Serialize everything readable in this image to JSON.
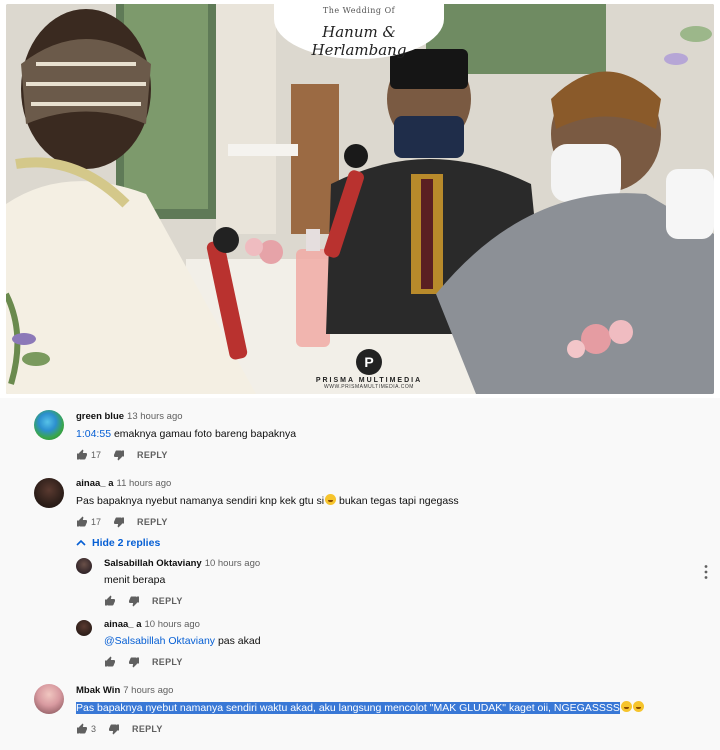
{
  "video": {
    "banner_small": "The Wedding Of",
    "banner_names": "Hanum & Herlambang",
    "watermark_text": "PRISMA MULTIMEDIA",
    "watermark_url": "WWW.PRISMAMULTIMEDIA.COM"
  },
  "comments": [
    {
      "author": "green blue",
      "time": "13 hours ago",
      "timestamp_link": "1:04:55",
      "text": " emaknya gamau foto bareng bapaknya",
      "likes": "17",
      "reply_label": "REPLY",
      "avatar_color": "#4caf50"
    },
    {
      "author": "ainaa_ a",
      "time": "11 hours ago",
      "text": "Pas bapaknya nyebut namanya sendiri knp kek gtu si",
      "text_after_emoji": " bukan tegas tapi ngegass",
      "likes": "17",
      "reply_label": "REPLY",
      "hide_replies_label": "Hide 2 replies"
    }
  ],
  "replies": [
    {
      "author": "Salsabillah Oktaviany",
      "time": "10 hours ago",
      "text": "menit berapa",
      "reply_label": "REPLY"
    },
    {
      "author": "ainaa_ a",
      "time": "10 hours ago",
      "mention": "@Salsabillah Oktaviany",
      "text": " pas akad",
      "reply_label": "REPLY"
    }
  ],
  "last_comment": {
    "author": "Mbak Win",
    "time": "7 hours ago",
    "text": "Pas bapaknya nyebut namanya sendiri waktu akad, aku langsung mencolot \"MAK GLUDAK\" kaget oii, NGEGASSSS",
    "likes": "3",
    "reply_label": "REPLY"
  },
  "colors": {
    "link": "#065fd4",
    "selection": "#3978d6",
    "secondary_text": "#606060"
  },
  "icons": [
    "thumb-up-icon",
    "thumb-down-icon",
    "chevron-up-icon",
    "more-vert-icon",
    "laugh-emoji-icon"
  ]
}
